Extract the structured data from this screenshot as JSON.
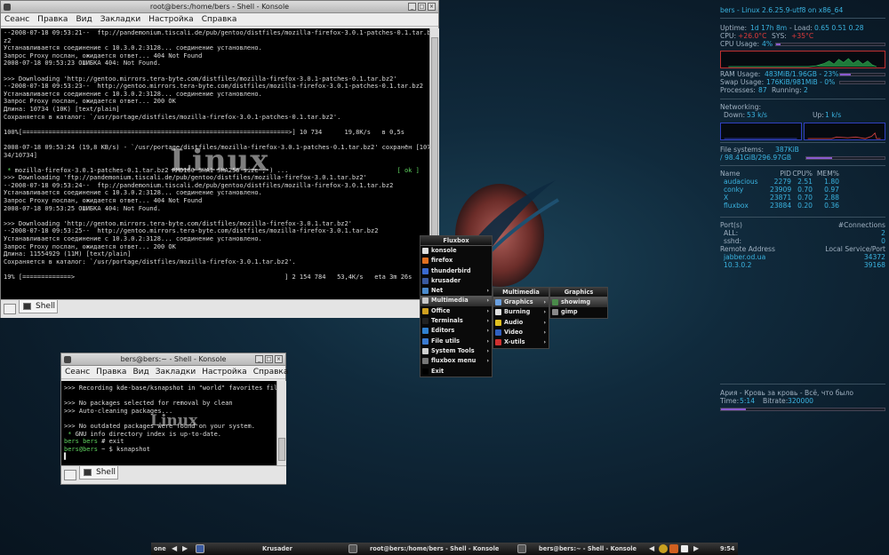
{
  "win1": {
    "title": "root@bers:/home/bers - Shell - Konsole",
    "menu": [
      "Сеанс",
      "Правка",
      "Вид",
      "Закладки",
      "Настройка",
      "Справка"
    ],
    "lines": [
      "--2008-07-18 09:53:21--  ftp://pandemonium.tiscali.de/pub/gentoo/distfiles/mozilla-firefox-3.0.1-patches-0.1.tar.b",
      "z2",
      "Устанавливается соединение с 10.3.0.2:3128... соединение установлено.",
      "Запрос Proxy послан, ожидается ответ... 404 Not Found",
      "2008-07-18 09:53:23 ОШИБКА 404: Not Found.",
      "",
      ">>> Downloading 'http://gentoo.mirrors.tera-byte.com/distfiles/mozilla-firefox-3.0.1-patches-0.1.tar.bz2'",
      "--2008-07-18 09:53:23--  http://gentoo.mirrors.tera-byte.com/distfiles/mozilla-firefox-3.0.1-patches-0.1.tar.bz2",
      "Устанавливается соединение с 10.3.0.2:3128... соединение установлено.",
      "Запрос Proxy послан, ожидается ответ... 200 OK",
      "Длина: 10734 (10K) [text/plain]",
      "Сохраняется в каталог: `/usr/portage/distfiles/mozilla-firefox-3.0.1-patches-0.1.tar.bz2'.",
      "",
      "100%[=======================================================================>] 10 734      19,8K/s   в 0,5s",
      "",
      "2008-07-18 09:53:24 (19,8 KB/s) - `/usr/portage/distfiles/mozilla-firefox-3.0.1-patches-0.1.tar.bz2' сохранён [107",
      "34/10734]",
      "",
      " * mozilla-firefox-3.0.1-patches-0.1.tar.bz2 RMD160 SHA1 SHA256 size ;-) ...                             [ ok ]",
      ">>> Downloading 'ftp://pandemonium.tiscali.de/pub/gentoo/distfiles/mozilla-firefox-3.0.1.tar.bz2'",
      "--2008-07-18 09:53:24--  ftp://pandemonium.tiscali.de/pub/gentoo/distfiles/mozilla-firefox-3.0.1.tar.bz2",
      "Устанавливается соединение с 10.3.0.2:3128... соединение установлено.",
      "Запрос Proxy послан, ожидается ответ... 404 Not Found",
      "2008-07-18 09:53:25 ОШИБКА 404: Not Found.",
      "",
      ">>> Downloading 'http://gentoo.mirrors.tera-byte.com/distfiles/mozilla-firefox-3.0.1.tar.bz2'",
      "--2008-07-18 09:53:25--  http://gentoo.mirrors.tera-byte.com/distfiles/mozilla-firefox-3.0.1.tar.bz2",
      "Устанавливается соединение с 10.3.0.2:3128... соединение установлено.",
      "Запрос Proxy послан, ожидается ответ... 200 OK",
      "Длина: 11554929 (11M) [text/plain]",
      "Сохраняется в каталог: `/usr/portage/distfiles/mozilla-firefox-3.0.1.tar.bz2'.",
      "",
      "19% [=============>                                                        ] 2 154 784   53,4K/s   eta 3m 26s"
    ],
    "tab": "Shell",
    "watermark": "Linux"
  },
  "win2": {
    "title": "bers@bers:~ - Shell - Konsole",
    "menu": [
      "Сеанс",
      "Правка",
      "Вид",
      "Закладки",
      "Настройка",
      "Справка"
    ],
    "lines": [
      ">>> Recording kde-base/ksnapshot in \"world\" favorites fil",
      "",
      ">>> No packages selected for removal by clean",
      ">>> Auto-cleaning packages...",
      "",
      ">>> No outdated packages were found on your system.",
      " * GNU info directory index is up-to-date.",
      "bers bers # exit",
      "bers@bers ~ $ ksnapshot",
      "▌"
    ],
    "tab": "Shell",
    "watermark": "Linux"
  },
  "fluxbox": {
    "title": "Fluxbox",
    "items": [
      {
        "label": "konsole",
        "sub": false
      },
      {
        "label": "firefox",
        "sub": false
      },
      {
        "label": "thunderbird",
        "sub": false
      },
      {
        "label": "krusader",
        "sub": false
      },
      {
        "label": "Net",
        "sub": true
      },
      {
        "label": "Multimedia",
        "sub": true
      },
      {
        "label": "Office",
        "sub": true
      },
      {
        "label": "Terminals",
        "sub": true
      },
      {
        "label": "Editors",
        "sub": true
      },
      {
        "label": "File utils",
        "sub": true
      },
      {
        "label": "System Tools",
        "sub": true
      },
      {
        "label": "fluxbox menu",
        "sub": true
      },
      {
        "label": "Exit",
        "sub": false
      }
    ],
    "multimedia": {
      "title": "Multimedia",
      "items": [
        "Graphics",
        "Burning",
        "Audio",
        "Video",
        "X-utils"
      ]
    },
    "graphics": {
      "title": "Graphics",
      "items": [
        "showimg",
        "gimp"
      ]
    }
  },
  "conky": {
    "header": "bers - Linux 2.6.25.9-utf8 on x86_64",
    "uptime_label": "Uptime:",
    "uptime": "1d 17h 8m",
    "load_label": "- Load:",
    "load": "0.65 0.51 0.28",
    "cpu_label": "CPU:",
    "cpu_temp": "+26.0°C",
    "sys_label": "SYS:",
    "sys_temp": "+35°C",
    "cpu_usage_label": "CPU Usage:",
    "cpu_usage": "4%",
    "cpu_usage_frac": 0.04,
    "ram_label": "RAM Usage:",
    "ram": "483MiB/1.96GB - 23%",
    "ram_frac": 0.23,
    "swap_label": "Swap Usage:",
    "swap": "176KiB/981MiB - 0%",
    "swap_frac": 0.0,
    "proc_label": "Processes:",
    "proc": "87",
    "running_label": "Running:",
    "running": "2",
    "net_label": "Networking:",
    "down_label": "Down:",
    "down": "53 k/s",
    "up_label": "Up:",
    "up": "1 k/s",
    "fs_label": "File systems:",
    "fs_size": "387KiB",
    "fs_root": "/ 98.41GiB/296.97GB",
    "fs_frac": 0.33,
    "ps_headers": [
      "Name",
      "PID",
      "CPU%",
      "MEM%"
    ],
    "ps": [
      [
        "audacious",
        "2279",
        "2.51",
        "1.80"
      ],
      [
        "conky",
        "23909",
        "0.70",
        "0.97"
      ],
      [
        "X",
        "23871",
        "0.70",
        "2.88"
      ],
      [
        "fluxbox",
        "23884",
        "0.20",
        "0.36"
      ]
    ],
    "ports_label": "Port(s)",
    "conn_label": "#Connections",
    "all_label": "ALL:",
    "all": "2",
    "sshd_label": "sshd:",
    "sshd": "0",
    "remote_label": "Remote Address",
    "local_label": "Local Service/Port",
    "conns": [
      [
        "jabber.od.ua",
        "34372"
      ],
      [
        "10.3.0.2",
        "39168"
      ]
    ],
    "song": "Ария - Кровь за кровь - Всё, что было",
    "time_label": "Time:",
    "time": "5:14",
    "bitrate_label": "Bitrate:",
    "bitrate": "320000",
    "song_frac": 0.15
  },
  "taskbar": {
    "workspace": "one",
    "items": [
      "Krusader",
      "root@bers:/home/bers - Shell - Konsole",
      "bers@bers:~ - Shell - Konsole"
    ],
    "clock": "9:54"
  }
}
